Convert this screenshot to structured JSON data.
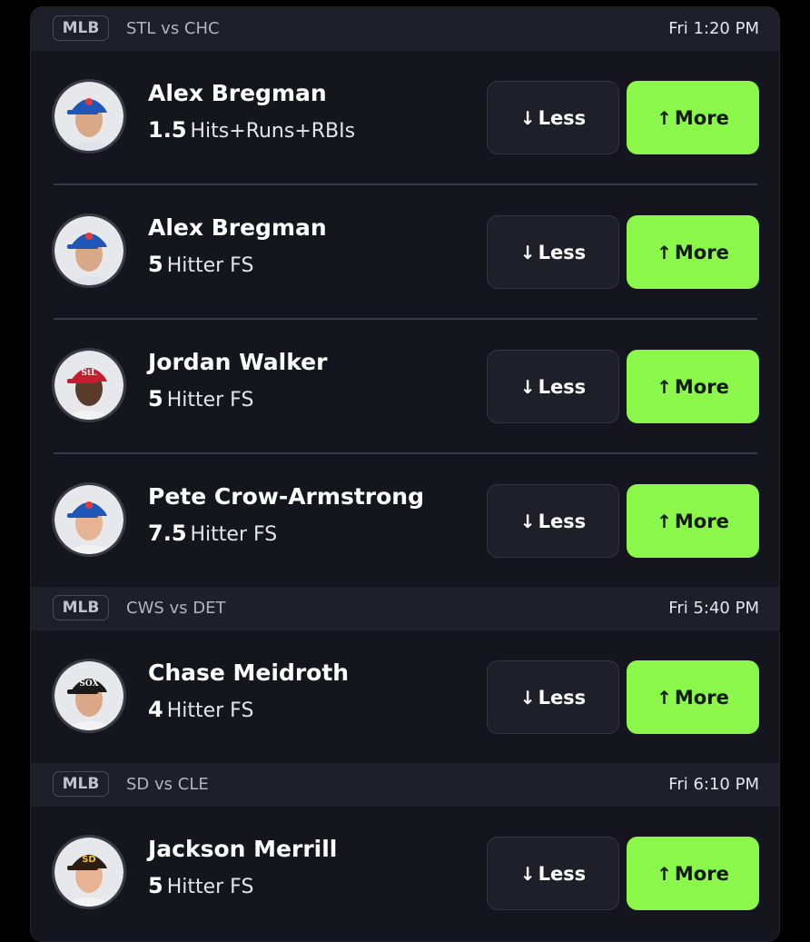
{
  "colors": {
    "accent": "#8af74a",
    "card_bg": "#15151e",
    "header_bg": "#1f1f29"
  },
  "games": [
    {
      "league": "MLB",
      "matchup": "STL vs CHC",
      "time": "Fri 1:20 PM",
      "picks": [
        {
          "player": "Alex Bregman",
          "line": "1.5",
          "stat": "Hits+Runs+RBIs",
          "cap_color": "#1f57b8",
          "cap_logo": "cubs-logo"
        },
        {
          "player": "Alex Bregman",
          "line": "5",
          "stat": "Hitter FS",
          "cap_color": "#1f57b8",
          "cap_logo": "cubs-logo"
        },
        {
          "player": "Jordan Walker",
          "line": "5",
          "stat": "Hitter FS",
          "cap_color": "#c41e2f",
          "cap_logo": "cardinals-logo"
        },
        {
          "player": "Pete Crow-Armstrong",
          "line": "7.5",
          "stat": "Hitter FS",
          "cap_color": "#1f57b8",
          "cap_logo": "cubs-logo"
        }
      ]
    },
    {
      "league": "MLB",
      "matchup": "CWS vs DET",
      "time": "Fri 5:40 PM",
      "picks": [
        {
          "player": "Chase Meidroth",
          "line": "4",
          "stat": "Hitter FS",
          "cap_color": "#1a1a1a",
          "cap_logo": "white-sox-logo"
        }
      ]
    },
    {
      "league": "MLB",
      "matchup": "SD vs CLE",
      "time": "Fri 6:10 PM",
      "picks": [
        {
          "player": "Jackson Merrill",
          "line": "5",
          "stat": "Hitter FS",
          "cap_color": "#2b1d12",
          "cap_logo": "padres-logo"
        }
      ]
    }
  ],
  "buttons": {
    "less_label": "Less",
    "more_label": "More",
    "less_icon": "arrow-down-icon",
    "more_icon": "arrow-up-icon"
  }
}
